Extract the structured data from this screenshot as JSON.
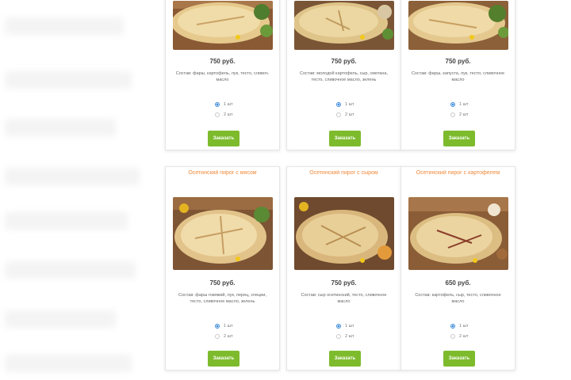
{
  "cards_top": [
    {
      "title": "",
      "image": "pie-photo",
      "price": "750 руб.",
      "description": "Состав: фарш, картофель, лук, тесто, сливоч. масло",
      "options": [
        {
          "label": "1 шт",
          "checked": true
        },
        {
          "label": "2 шт",
          "checked": false
        }
      ],
      "button": "Заказать"
    },
    {
      "title": "",
      "image": "pie-photo",
      "price": "750 руб.",
      "description": "Состав: молодой картофель, сыр, сметана, тесто, сливочное масло, зелень",
      "options": [
        {
          "label": "1 шт",
          "checked": true
        },
        {
          "label": "2 шт",
          "checked": false
        }
      ],
      "button": "Заказать"
    },
    {
      "title": "",
      "image": "pie-photo",
      "price": "750 руб.",
      "description": "Состав: фарш, капуста, лук, тесто, сливочное масло",
      "options": [
        {
          "label": "1 шт",
          "checked": true
        },
        {
          "label": "2 шт",
          "checked": false
        }
      ],
      "button": "Заказать"
    }
  ],
  "cards_bottom": [
    {
      "title": "Осетинский пирог с мясом",
      "image": "pie-photo",
      "price": "750 руб.",
      "description": "Состав: фарш говяжий, лук, перец, специи, тесто, сливочное масло, зелень",
      "options": [
        {
          "label": "1 шт",
          "checked": true
        },
        {
          "label": "2 шт",
          "checked": false
        }
      ],
      "button": "Заказать"
    },
    {
      "title": "Осетинский пирог с сыром",
      "image": "pie-photo",
      "price": "750 руб.",
      "description": "Состав: сыр осетинский, тесто, сливочное масло",
      "options": [
        {
          "label": "1 шт",
          "checked": true
        },
        {
          "label": "2 шт",
          "checked": false
        }
      ],
      "button": "Заказать"
    },
    {
      "title": "Осетинский пирог с картофелем",
      "image": "pie-photo",
      "price": "650 руб.",
      "description": "Состав: картофель, сыр, тесто, сливочное масло",
      "options": [
        {
          "label": "1 шт",
          "checked": true
        },
        {
          "label": "2 шт",
          "checked": false
        }
      ],
      "button": "Заказать"
    }
  ],
  "colors": {
    "title": "#f08a3c",
    "button": "#7dbb2d",
    "radio_checked": "#3d8bd8"
  }
}
